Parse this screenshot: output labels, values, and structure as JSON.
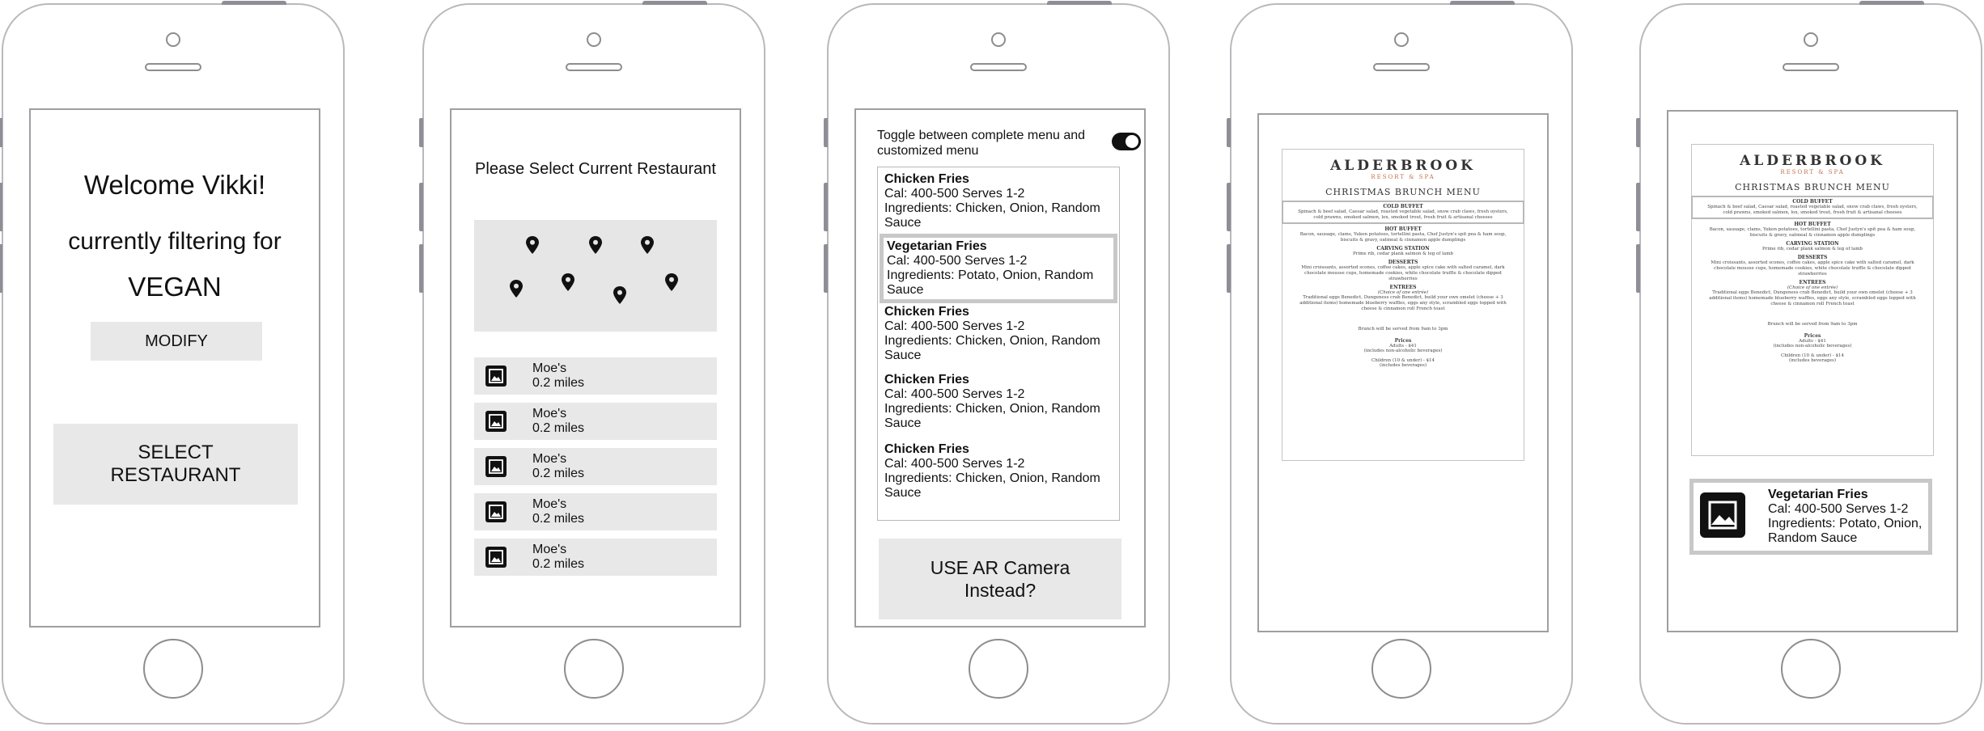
{
  "screen1": {
    "welcome": "Welcome Vikki!",
    "filtering_label": "currently filtering for",
    "diet": "VEGAN",
    "modify_label": "MODIFY",
    "select_label_line1": "SELECT",
    "select_label_line2": "RESTAURANT"
  },
  "screen2": {
    "title": "Please Select Current Restaurant",
    "map_pins": 7,
    "restaurants": [
      {
        "name": "Moe's",
        "distance": "0.2 miles"
      },
      {
        "name": "Moe's",
        "distance": "0.2 miles"
      },
      {
        "name": "Moe's",
        "distance": "0.2 miles"
      },
      {
        "name": "Moe's",
        "distance": "0.2 miles"
      },
      {
        "name": "Moe's",
        "distance": "0.2 miles"
      }
    ]
  },
  "screen3": {
    "toggle_label": "Toggle between complete menu and customized menu",
    "toggle_on": true,
    "items": [
      {
        "name": "Chicken Fries",
        "cal": "Cal: 400-500  Serves 1-2",
        "ingredients": "Ingredients: Chicken, Onion, Random Sauce"
      },
      {
        "name": "Vegetarian Fries",
        "cal": "Cal: 400-500  Serves 1-2",
        "ingredients": "Ingredients: Potato, Onion, Random Sauce"
      },
      {
        "name": "Chicken Fries",
        "cal": "Cal: 400-500  Serves 1-2",
        "ingredients": "Ingredients: Chicken, Onion, Random Sauce"
      },
      {
        "name": "Chicken Fries",
        "cal": "Cal: 400-500  Serves 1-2",
        "ingredients": "Ingredients: Chicken, Onion, Random Sauce"
      },
      {
        "name": "Chicken Fries",
        "cal": "Cal: 400-500  Serves 1-2",
        "ingredients": "Ingredients: Chicken, Onion, Random Sauce"
      }
    ],
    "ar_line1": "USE AR Camera",
    "ar_line2": "Instead?"
  },
  "menu_doc": {
    "logo": "ALDERBROOK",
    "logo_sub": "RESORT & SPA",
    "title": "CHRISTMAS BRUNCH MENU",
    "cold_title": "COLD BUFFET",
    "cold_text": "Spinach & beef salad, Caesar salad, roasted vegetable salad, snow crab claws, fresh oysters, cold prawns, smoked salmon, lox, smoked trout, fresh fruit & artisanal cheeses",
    "hot_title": "HOT BUFFET",
    "hot_text": "Bacon, sausage, clams, Yukon potatoes, tortellini pasta, Chef Justyn's spit pea & ham soup, biscuits & gravy, oatmeal & cinnamon apple dumplings",
    "carving_title": "CARVING STATION",
    "carving_text": "Prime rib, cedar plank salmon & leg of lamb",
    "desserts_title": "DESSERTS",
    "desserts_text": "Mini croissants, assorted scones, coffee cakes, apple spice cake with salted caramel, dark chocolate mousse cups, homemade cookies, white chocolate truffle & chocolate dipped strawberries",
    "entrees_title": "ENTREES",
    "entrees_sub": "(Choice of one entrée)",
    "entrees_text": "Traditional eggs Benedict, Dungeness crab Benedict, build your own omelet (cheese + 3 additional items) homemade blueberry waffles, eggs any style, scrambled eggs topped with cheese & cinnamon roll French toast",
    "served": "Brunch will be served from 9am to 3pm",
    "prices_title": "Prices",
    "adults": "Adults - $41",
    "adults_note": "(includes non-alcoholic beverages)",
    "children": "Children (10 & under) - $14",
    "children_note": "(includes beverages)"
  },
  "screen5": {
    "card_name": "Vegetarian Fries",
    "card_cal": "Cal: 400-500  Serves 1-2",
    "card_ingredients": "Ingredients: Potato, Onion, Random Sauce"
  },
  "colors": {
    "button_grey": "#e8e8e8",
    "phone_outline": "#b9b9bd",
    "logo_accent": "#c0704a"
  }
}
